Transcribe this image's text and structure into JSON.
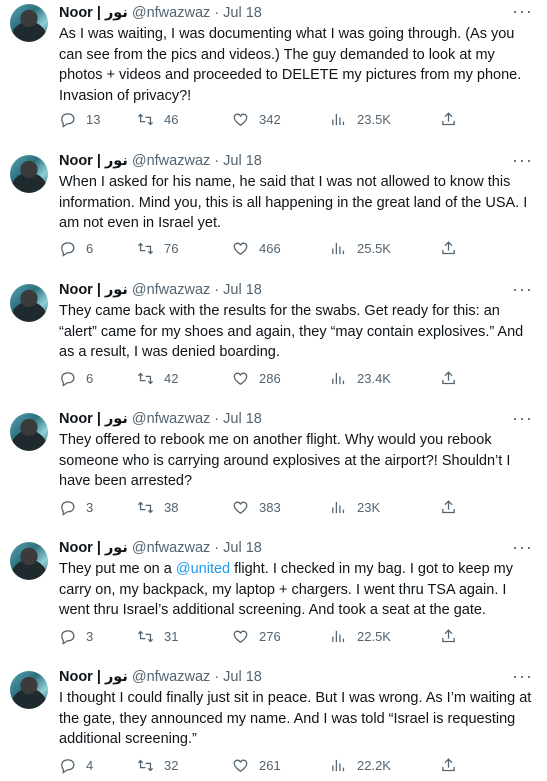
{
  "tweets": [
    {
      "name": "Noor | نور",
      "handle": "@nfwazwaz",
      "date": "Jul 18",
      "text_parts": [
        "As I was waiting, I was documenting what I was going through. (As you can see from the pics and videos.) The guy demanded to look at my photos + videos and proceeded to DELETE my pictures from my phone. Invasion of privacy?!"
      ],
      "replies": "13",
      "retweets": "46",
      "likes": "342",
      "views": "23.5K"
    },
    {
      "name": "Noor | نور",
      "handle": "@nfwazwaz",
      "date": "Jul 18",
      "text_parts": [
        "When I asked for his name, he said that I was not allowed to know this information. Mind you, this is all happening in the great land of the USA. I am not even in Israel yet."
      ],
      "replies": "6",
      "retweets": "76",
      "likes": "466",
      "views": "25.5K"
    },
    {
      "name": "Noor | نور",
      "handle": "@nfwazwaz",
      "date": "Jul 18",
      "text_parts": [
        "They came back with the results for the swabs. Get ready for this: an “alert” came for my shoes and again, they “may contain explosives.” And as a result, I was denied boarding."
      ],
      "replies": "6",
      "retweets": "42",
      "likes": "286",
      "views": "23.4K"
    },
    {
      "name": "Noor | نور",
      "handle": "@nfwazwaz",
      "date": "Jul 18",
      "text_parts": [
        "They offered to rebook me on another flight. Why would you rebook someone who is carrying around explosives at the airport?! Shouldn’t I have been arrested?"
      ],
      "replies": "3",
      "retweets": "38",
      "likes": "383",
      "views": "23K"
    },
    {
      "name": "Noor | نور",
      "handle": "@nfwazwaz",
      "date": "Jul 18",
      "text_before": "They put me on a ",
      "mention": "@united",
      "text_after": " flight. I checked in my bag. I got to keep my carry on, my backpack, my laptop + chargers. I went thru TSA again. I went thru Israel’s additional screening. And took a seat at the gate.",
      "replies": "3",
      "retweets": "31",
      "likes": "276",
      "views": "22.5K"
    },
    {
      "name": "Noor | نور",
      "handle": "@nfwazwaz",
      "date": "Jul 18",
      "text_parts": [
        "I thought I could finally just sit in peace. But I was wrong. As I’m waiting at the gate, they announced my name. And I was told “Israel is requesting additional screening.”"
      ],
      "replies": "4",
      "retweets": "32",
      "likes": "261",
      "views": "22.2K"
    }
  ],
  "separator": "·",
  "icons": {
    "reply": "reply-icon",
    "retweet": "retweet-icon",
    "like": "heart-icon",
    "views": "views-icon",
    "share": "share-icon",
    "more": "more-icon"
  },
  "colors": {
    "text": "#0f1419",
    "secondary": "#536471",
    "link": "#1d9bf0"
  }
}
